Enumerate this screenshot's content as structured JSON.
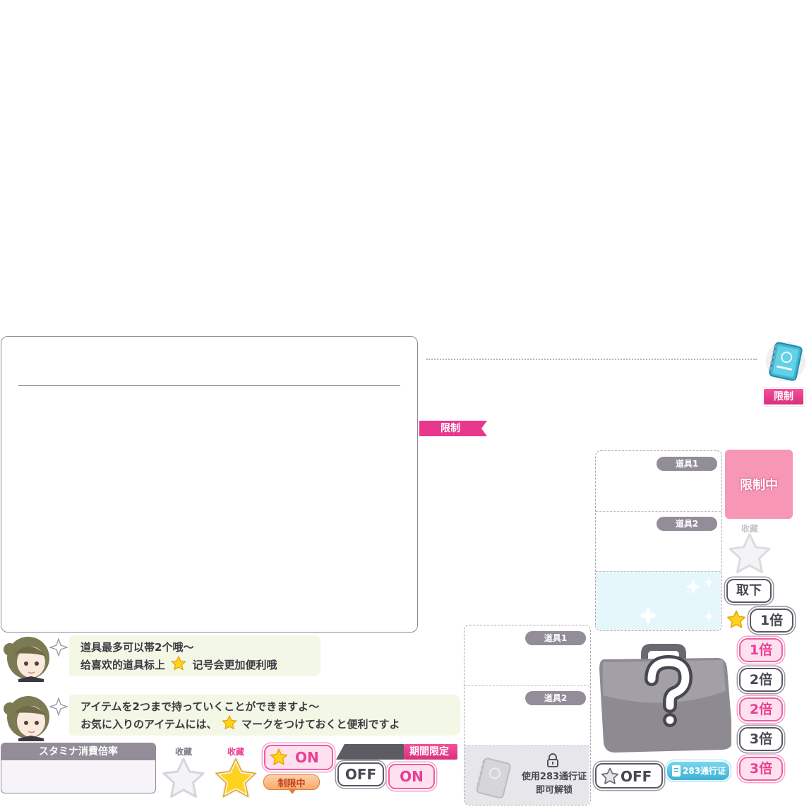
{
  "colors": {
    "accent_pink": "#e8378c",
    "panel_border": "#8d8996",
    "slot_tag": "#938d9a",
    "bubble_bg": "#f2f7e6",
    "cyan": "#56c3e0"
  },
  "limit_ribbon_top": "限制",
  "limit_ribbon_mid": "限制",
  "slots_right": {
    "slot1": "道具1",
    "slot2": "道具2"
  },
  "limited_button": "限制中",
  "collect_label_top": "收藏",
  "remove_button": "取下",
  "star_mult_label": "1倍",
  "tip_cn": {
    "line1": "道具最多可以帯2个哦～",
    "line2_a": "给喜欢的道具标上",
    "line2_b": "记号会更加便利哦"
  },
  "tip_jp": {
    "line1": "アイテムを2つまで持っていくことができますよ～",
    "line2_a": "お気に入りのアイテムには、",
    "line2_b": "マークをつけておくと便利ですよ"
  },
  "stamina": {
    "title": "スタミナ消費倍率"
  },
  "collect_off_label": "收藏",
  "collect_on_label": "收藏",
  "star_on_button": "ON",
  "limited_small": "制限中",
  "period_limited": "期間限定",
  "toggle": {
    "off": "OFF",
    "on": "ON"
  },
  "slots_left": {
    "slot1": "道具1",
    "slot2": "道具2"
  },
  "pass_lock": {
    "line1": "使用283通行证",
    "line2": "即可解锁"
  },
  "star_off_button": "OFF",
  "pass_badge": "283通行证",
  "multipliers": [
    "1倍",
    "2倍",
    "2倍",
    "3倍",
    "3倍"
  ],
  "icon_names": [
    "sparkle-icon",
    "star-icon",
    "lock-icon",
    "notebook-icon",
    "briefcase-icon",
    "question-icon"
  ]
}
